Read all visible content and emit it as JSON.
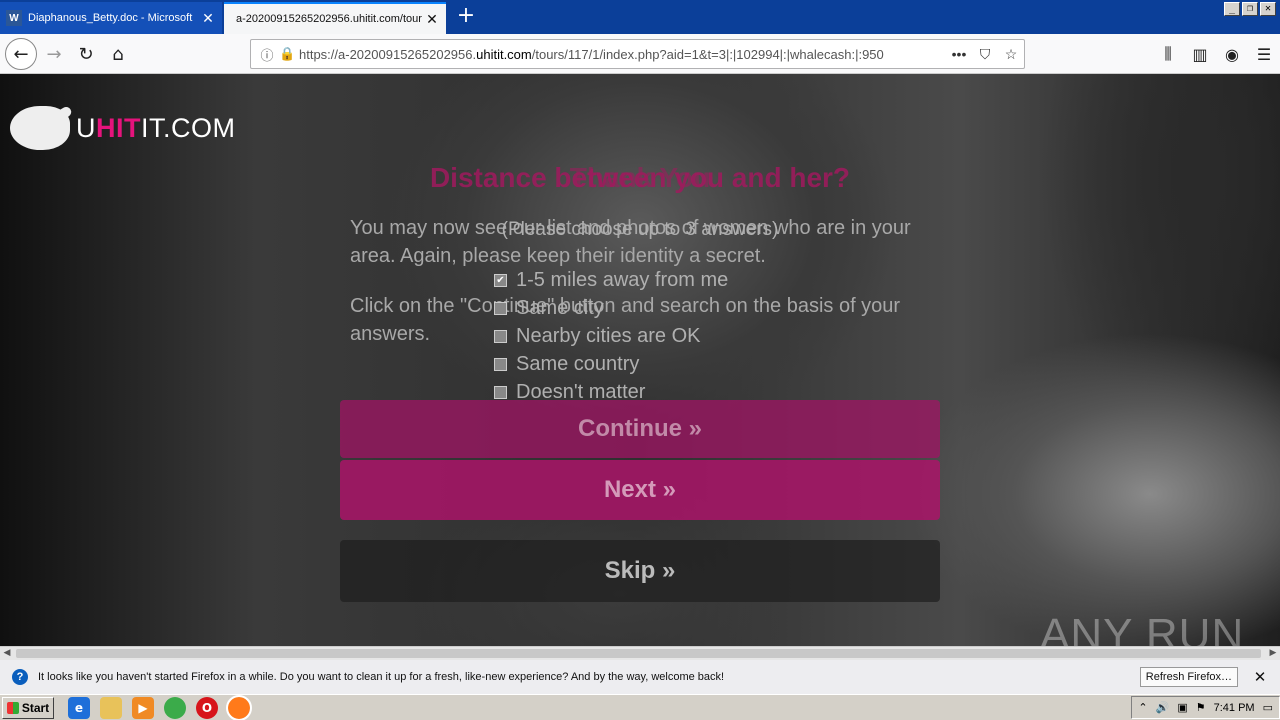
{
  "tabs": [
    {
      "icon": "W",
      "label": "Diaphanous_Betty.doc - Microsoft"
    },
    {
      "label": "a-20200915265202956.uhitit.com/tour"
    }
  ],
  "window_controls": {
    "minimize": "_",
    "restore": "❐",
    "close": "✕"
  },
  "address": {
    "url_prefix": "https://a-20200915265202956.",
    "url_domain": "uhitit.com",
    "url_suffix": "/tours/117/1/index.php?aid=1&t=3|:|102994|:|whalecash:|:950"
  },
  "logo": {
    "u": "U",
    "hit": "HIT",
    "rest": "IT.COM"
  },
  "page": {
    "heading_a": "Distance between you and her?",
    "heading_b": "Thank You",
    "subtitle": "(Please choose up to 3 answers)",
    "para1": "You may now see our list and photos of women who are in your area. Again, please keep their identity a secret.",
    "para2": "Click on the \"Continue\" button and search on the basis of your answers.",
    "options": [
      {
        "label": "1-5 miles away from me",
        "checked": true
      },
      {
        "label": "Same city",
        "checked": false
      },
      {
        "label": "Nearby cities are OK",
        "checked": false
      },
      {
        "label": "Same country",
        "checked": false
      },
      {
        "label": "Doesn't matter",
        "checked": false
      }
    ],
    "continue_label": "Continue »",
    "next_label": "Next »",
    "skip_label": "Skip »"
  },
  "watermark": "ANY RUN",
  "notification": {
    "message": "It looks like you haven't started Firefox in a while. Do you want to clean it up for a fresh, like-new experience? And by the way, welcome back!",
    "button": "Refresh Firefox…"
  },
  "taskbar": {
    "start_label": "Start",
    "clock": "7:41 PM"
  }
}
